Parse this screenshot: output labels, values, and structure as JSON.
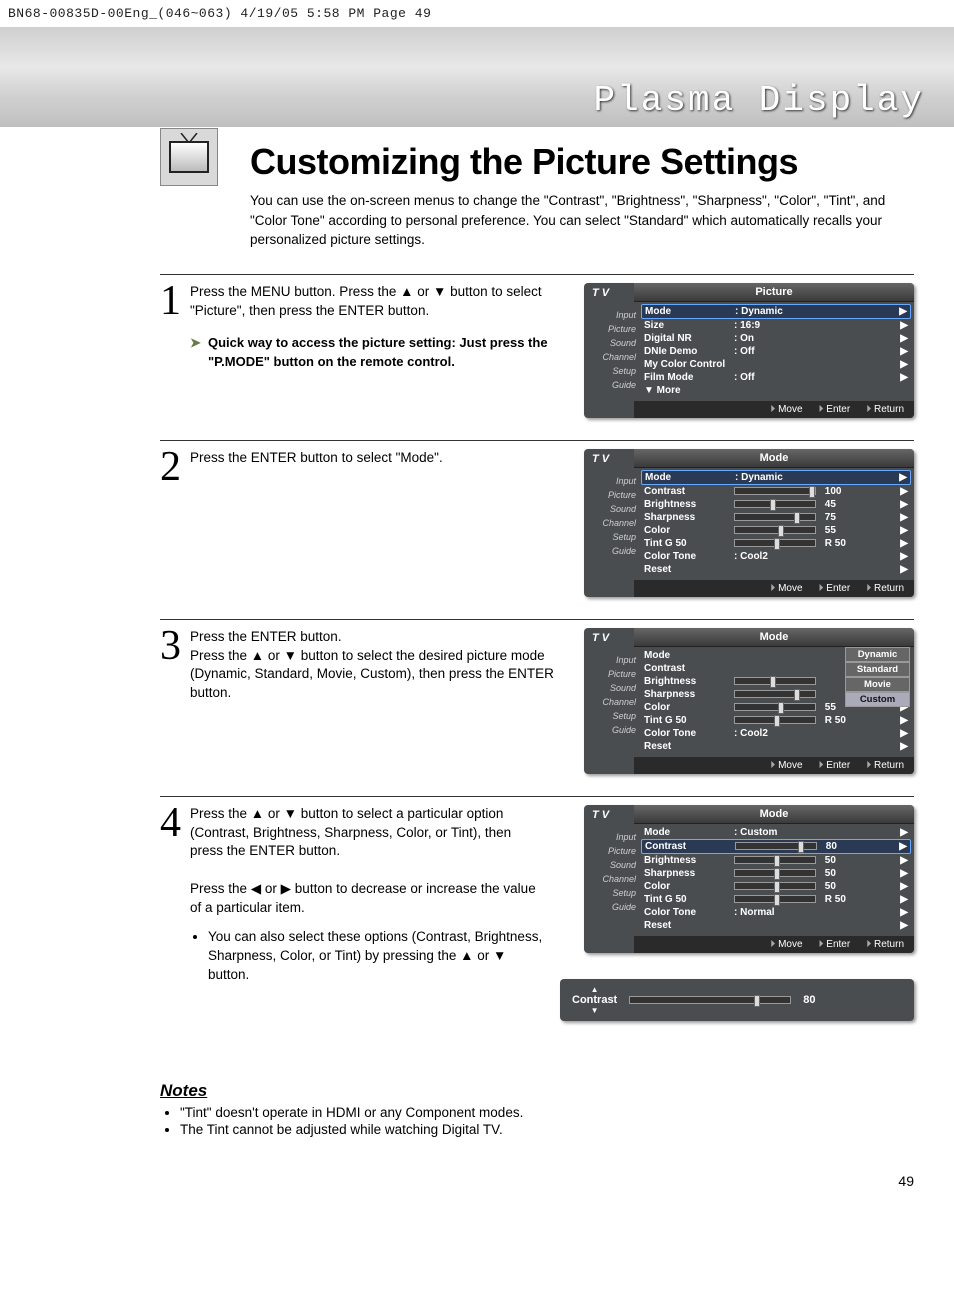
{
  "crop": "BN68-00835D-00Eng_(046~063)  4/19/05  5:58 PM  Page 49",
  "bandtitle": "Plasma Display",
  "title": "Customizing the Picture Settings",
  "intro": "You can use the on-screen menus to change the \"Contrast\", \"Brightness\", \"Sharpness\", \"Color\", \"Tint\", and \"Color Tone\" according to personal preference. You can select \"Standard\" which automatically recalls your personalized picture settings.",
  "steps": [
    {
      "num": "1",
      "text": "Press the MENU button. Press the ▲ or ▼ button to select \"Picture\", then press the ENTER button.",
      "quick": "Quick way to access the picture setting: Just press the \"P.MODE\" button on the remote control."
    },
    {
      "num": "2",
      "text": "Press the ENTER button to select \"Mode\"."
    },
    {
      "num": "3",
      "text": "Press the ENTER button.\nPress the ▲ or ▼ button to select the desired picture mode (Dynamic, Standard, Movie, Custom), then press the ENTER button."
    },
    {
      "num": "4",
      "text": "Press the ▲ or ▼ button to select a particular option (Contrast, Brightness, Sharpness, Color, or Tint), then press the ENTER button.\n\nPress the ◀ or ▶ button to decrease or increase the value of a particular item.",
      "bullet": "You can also select these options (Contrast, Brightness, Sharpness, Color, or Tint) by pressing the ▲ or ▼ button."
    }
  ],
  "sidebar": [
    "Input",
    "Picture",
    "Sound",
    "Channel",
    "Setup",
    "Guide"
  ],
  "osd1": {
    "title": "Picture",
    "rows": [
      {
        "l": "Mode",
        "v": ": Dynamic",
        "sel": true
      },
      {
        "l": "Size",
        "v": ": 16:9"
      },
      {
        "l": "Digital NR",
        "v": ": On"
      },
      {
        "l": "DNIe Demo",
        "v": ": Off"
      },
      {
        "l": "My Color Control",
        "v": ""
      },
      {
        "l": "Film Mode",
        "v": ": Off"
      },
      {
        "l": "▼ More",
        "v": "",
        "noarrow": true
      }
    ]
  },
  "osd2": {
    "title": "Mode",
    "rows": [
      {
        "l": "Mode",
        "v": ": Dynamic",
        "sel": true,
        "arrow": true
      },
      {
        "l": "Contrast",
        "slider": 95,
        "v": "100"
      },
      {
        "l": "Brightness",
        "slider": 45,
        "v": "45"
      },
      {
        "l": "Sharpness",
        "slider": 75,
        "v": "75"
      },
      {
        "l": "Color",
        "slider": 55,
        "v": "55"
      },
      {
        "l": "Tint    G 50",
        "slider": 50,
        "v": "R 50"
      },
      {
        "l": "Color Tone",
        "v": ": Cool2",
        "arrow": true
      },
      {
        "l": "Reset",
        "v": ""
      }
    ]
  },
  "osd3": {
    "title": "Mode",
    "options": [
      "Dynamic",
      "Standard",
      "Movie",
      "Custom"
    ],
    "rows": [
      {
        "l": "Mode",
        "v": ""
      },
      {
        "l": "Contrast",
        "v": ""
      },
      {
        "l": "Brightness",
        "slider": 45,
        "v": ""
      },
      {
        "l": "Sharpness",
        "slider": 75,
        "v": ""
      },
      {
        "l": "Color",
        "slider": 55,
        "v": "55"
      },
      {
        "l": "Tint    G 50",
        "slider": 50,
        "v": "R 50"
      },
      {
        "l": "Color Tone",
        "v": ": Cool2"
      },
      {
        "l": "Reset",
        "v": ""
      }
    ]
  },
  "osd4": {
    "title": "Mode",
    "rows": [
      {
        "l": "Mode",
        "v": ": Custom",
        "arrow": true
      },
      {
        "l": "Contrast",
        "slider": 80,
        "v": "80",
        "sel": true
      },
      {
        "l": "Brightness",
        "slider": 50,
        "v": "50"
      },
      {
        "l": "Sharpness",
        "slider": 50,
        "v": "50"
      },
      {
        "l": "Color",
        "slider": 50,
        "v": "50"
      },
      {
        "l": "Tint    G 50",
        "slider": 50,
        "v": "R 50"
      },
      {
        "l": "Color Tone",
        "v": ": Normal",
        "arrow": true
      },
      {
        "l": "Reset",
        "v": ""
      }
    ]
  },
  "footer": {
    "move": "Move",
    "enter": "Enter",
    "ret": "Return"
  },
  "adjust": {
    "label": "Contrast",
    "value": "80",
    "pos": 80
  },
  "notesTitle": "Notes",
  "notes": [
    "\"Tint\" doesn't operate in HDMI or any Component modes.",
    "The Tint cannot be adjusted while watching Digital TV."
  ],
  "pagenum": "49",
  "tvlabel": "T V"
}
